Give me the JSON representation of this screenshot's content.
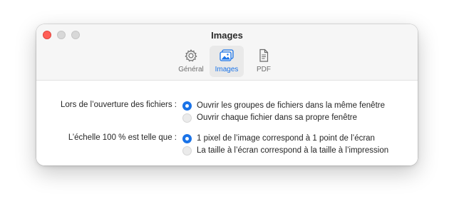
{
  "window": {
    "title": "Images"
  },
  "toolbar": {
    "tabs": [
      {
        "label": "Général",
        "icon": "gear-icon",
        "selected": false
      },
      {
        "label": "Images",
        "icon": "photos-icon",
        "selected": true
      },
      {
        "label": "PDF",
        "icon": "document-icon",
        "selected": false
      }
    ]
  },
  "settings": {
    "opening": {
      "label": "Lors de l’ouverture des fichiers :",
      "options": [
        {
          "text": "Ouvrir les groupes de fichiers dans la même fenêtre",
          "selected": true
        },
        {
          "text": "Ouvrir chaque fichier dans sa propre fenêtre",
          "selected": false
        }
      ]
    },
    "scale": {
      "label": "L’échelle 100 % est telle que :",
      "options": [
        {
          "text": "1 pixel de l’image correspond à 1 point de l’écran",
          "selected": true
        },
        {
          "text": "La taille à l’écran correspond à la taille à l’impression",
          "selected": false
        }
      ]
    }
  },
  "colors": {
    "accent": "#1a73e8",
    "close_button": "#ff5f57"
  }
}
